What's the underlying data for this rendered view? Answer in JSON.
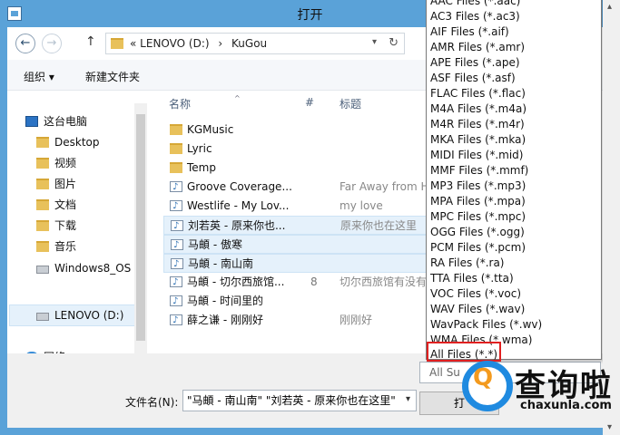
{
  "window": {
    "title": "打开"
  },
  "address": {
    "overflow": "«",
    "crumb1": "LENOVO (D:)",
    "sep": "›",
    "crumb2": "KuGou"
  },
  "toolbar": {
    "organize": "组织 ▾",
    "new_folder": "新建文件夹"
  },
  "columns": {
    "name": "名称",
    "number": "#",
    "title": "标题"
  },
  "nav": [
    {
      "label": "这台电脑",
      "icon": "computer-icon"
    },
    {
      "label": "Desktop",
      "icon": "folder-icon"
    },
    {
      "label": "视频",
      "icon": "folder-icon"
    },
    {
      "label": "图片",
      "icon": "folder-icon"
    },
    {
      "label": "文档",
      "icon": "folder-icon"
    },
    {
      "label": "下载",
      "icon": "folder-icon"
    },
    {
      "label": "音乐",
      "icon": "folder-icon"
    },
    {
      "label": "Windows8_OS (",
      "icon": "drive-icon"
    },
    {
      "label": "LENOVO (D:)",
      "icon": "drive-icon"
    },
    {
      "label": "网络",
      "icon": "network-icon"
    }
  ],
  "files": [
    {
      "name": "KGMusic",
      "num": "",
      "title": "",
      "type": "folder"
    },
    {
      "name": "Lyric",
      "num": "",
      "title": "",
      "type": "folder"
    },
    {
      "name": "Temp",
      "num": "",
      "title": "",
      "type": "folder"
    },
    {
      "name": "Groove Coverage...",
      "num": "",
      "title": "Far Away from H",
      "type": "audio"
    },
    {
      "name": "Westlife - My Lov...",
      "num": "",
      "title": "my love",
      "type": "audio"
    },
    {
      "name": "刘若英 - 原来你也...",
      "num": "",
      "title": "原来你也在这里",
      "type": "audio",
      "selected": true
    },
    {
      "name": "马頔 - 傲寒",
      "num": "",
      "title": "",
      "type": "audio",
      "selected": true
    },
    {
      "name": "马頔 - 南山南",
      "num": "",
      "title": "",
      "type": "audio",
      "selected": true
    },
    {
      "name": "马頔 - 切尔西旅馆...",
      "num": "8",
      "title": "切尔西旅馆有没有",
      "type": "audio"
    },
    {
      "name": "马頔 - 时间里的",
      "num": "",
      "title": "",
      "type": "audio"
    },
    {
      "name": "薛之谦 - 刚刚好",
      "num": "",
      "title": "刚刚好",
      "type": "audio"
    }
  ],
  "filename": {
    "label": "文件名(N):",
    "value": "\"马頔 - 南山南\" \"刘若英 - 原来你也在这里\""
  },
  "filter": {
    "current": "All Su",
    "open_button": "打"
  },
  "filetypes": [
    "AAC Files (*.aac)",
    "AC3 Files (*.ac3)",
    "AIF Files (*.aif)",
    "AMR Files (*.amr)",
    "APE Files (*.ape)",
    "ASF Files (*.asf)",
    "FLAC Files (*.flac)",
    "M4A Files (*.m4a)",
    "M4R Files (*.m4r)",
    "MKA Files (*.mka)",
    "MIDI Files (*.mid)",
    "MMF Files (*.mmf)",
    "MP3 Files (*.mp3)",
    "MPA Files (*.mpa)",
    "MPC Files (*.mpc)",
    "OGG Files (*.ogg)",
    "PCM Files (*.pcm)",
    "RA Files (*.ra)",
    "TTA Files (*.tta)",
    "VOC Files (*.voc)",
    "WAV Files (*.wav)",
    "WavPack Files (*.wv)",
    "WMA Files (*.wma)",
    "All Files (*.*)"
  ],
  "watermark": {
    "brand": "查询啦",
    "url": "chaxunla.com"
  },
  "colors": {
    "titlebar": "#5aa2d8",
    "selection": "#e5f1fb",
    "highlight_box": "#e02020"
  }
}
